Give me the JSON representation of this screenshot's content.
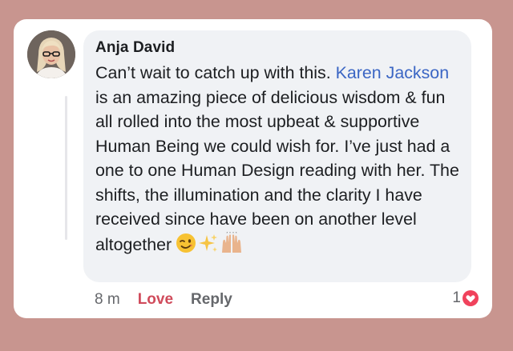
{
  "comment": {
    "author": "Anja David",
    "text_before_mention": "Can’t wait to catch up with this. ",
    "mention": "Karen Jackson",
    "text_after_mention": " is an amazing piece of delicious wisdom & fun all rolled into the most upbeat & supportive Human Being we could wish for. I’ve just had a one to one Human Design reading with her. The shifts, the illumination and the clarity I have received since have been on another level altogether",
    "emojis": [
      "winking-face",
      "sparkles",
      "raising-hands"
    ],
    "timestamp": "8 m",
    "love_label": "Love",
    "reply_label": "Reply",
    "reaction_count": "1",
    "reaction_type": "love-heart"
  },
  "colors": {
    "background": "#c8958f",
    "bubble": "#f0f2f5",
    "mention": "#3b66c4",
    "love": "#d04b5b",
    "meta": "#65676b"
  }
}
